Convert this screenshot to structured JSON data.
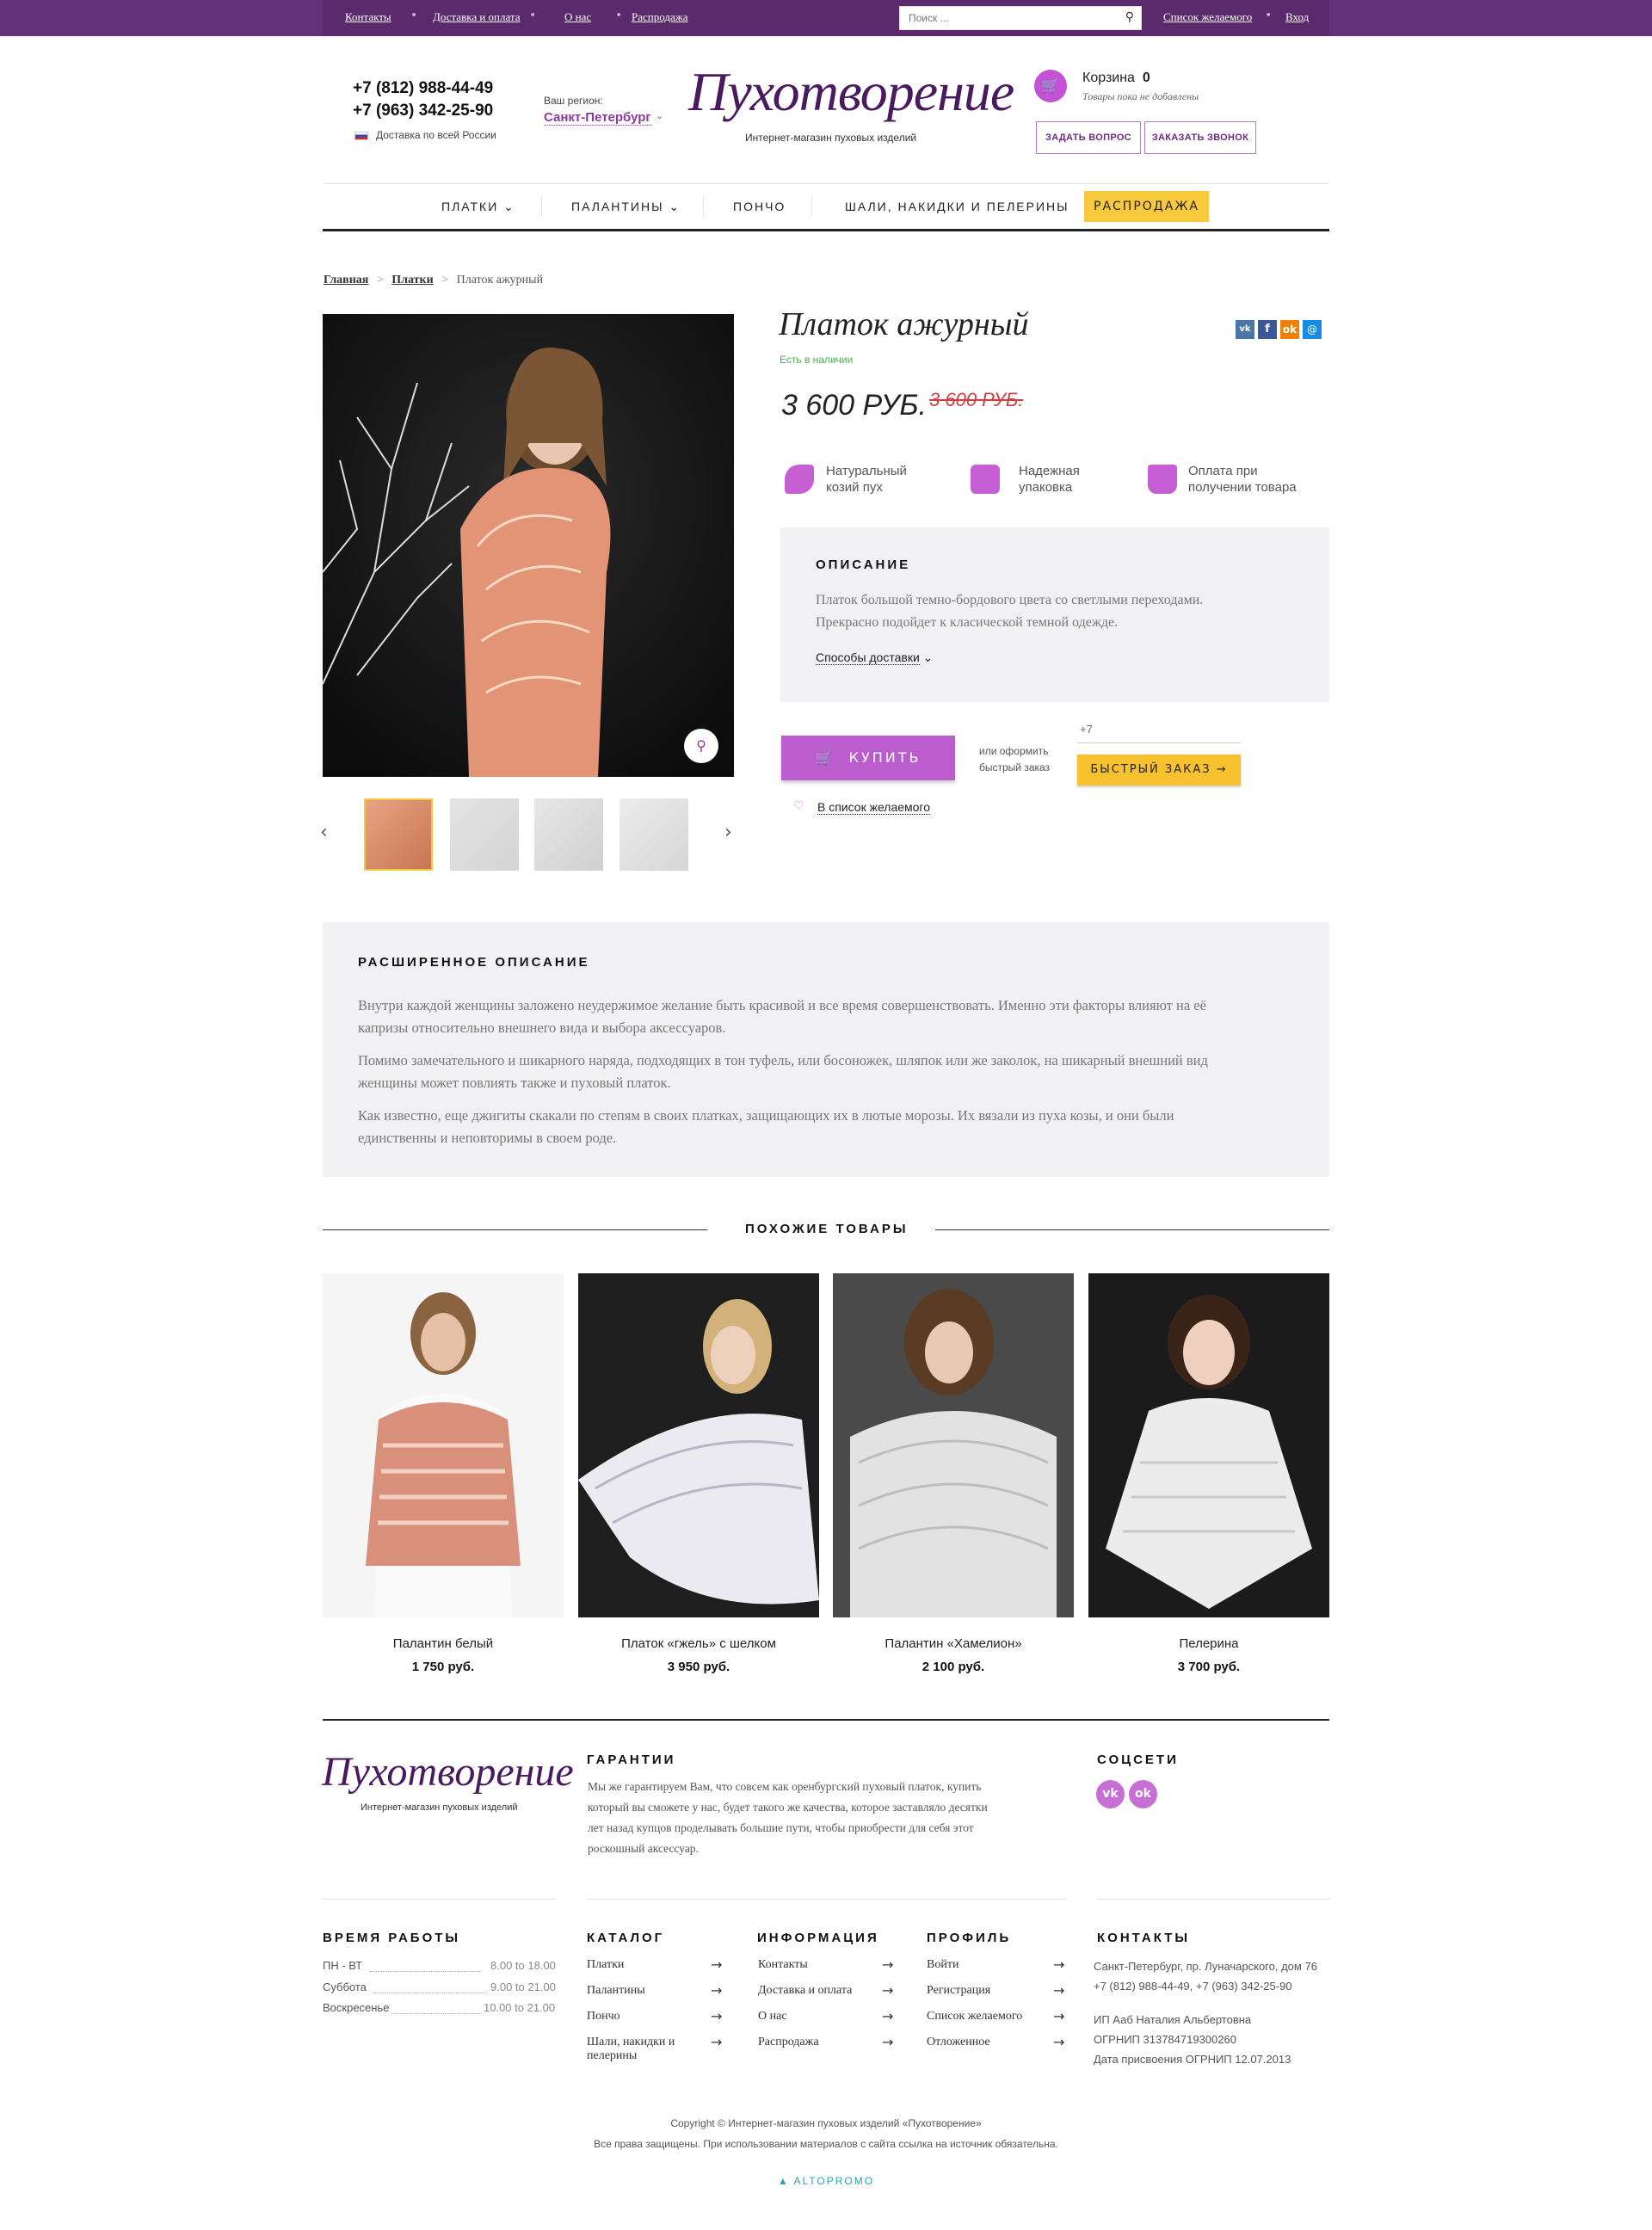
{
  "topbar": {
    "links": [
      "Контакты",
      "Доставка и оплата",
      "О нас",
      "Распродажа"
    ],
    "search_placeholder": "Поиск ...",
    "wishlist": "Список желаемого",
    "login": "Вход"
  },
  "header": {
    "phone1": "+7 (812) 988-44-49",
    "phone2": "+7 (963) 342-25-90",
    "delivery": "Доставка по всей России",
    "region_label": "Ваш регион:",
    "region": "Санкт-Петербург",
    "logo": "Пухотворение",
    "logo_sub": "Интернет-магазин пуховых изделий",
    "cart_label": "Корзина",
    "cart_count": "0",
    "cart_empty": "Товары пока не добавлены",
    "ask_button": "ЗАДАТЬ ВОПРОС",
    "call_button": "ЗАКАЗАТЬ ЗВОНОК"
  },
  "nav": {
    "items": [
      "ПЛАТКИ",
      "ПАЛАНТИНЫ",
      "ПОНЧО",
      "ШАЛИ, НАКИДКИ И ПЕЛЕРИНЫ"
    ],
    "sale": "РАСПРОДАЖА"
  },
  "breadcrumb": [
    "Главная",
    "Платки",
    "Платок ажурный"
  ],
  "product": {
    "title": "Платок ажурный",
    "stock": "Есть в наличии",
    "price": "3 600 РУБ.",
    "old_price": "3 600 РУБ.",
    "features": [
      {
        "line1": "Натуральный",
        "line2": "козий пух"
      },
      {
        "line1": "Надежная",
        "line2": "упаковка"
      },
      {
        "line1": "Оплата при",
        "line2": "получении товара"
      }
    ],
    "desc_title": "ОПИСАНИЕ",
    "desc_line1": "Платок большой темно-бордового цвета со светлыми переходами.",
    "desc_line2": "Прекрасно подойдет к класической темной одежде.",
    "delivery_toggle": "Способы доставки",
    "buy": "КУПИТЬ",
    "or1": "или оформить",
    "or2": "быстрый заказ",
    "phone_prefix": "+7",
    "quick": "БЫСТРЫЙ ЗАКАЗ →",
    "wishlist": "В список желаемого"
  },
  "extended": {
    "title": "РАСШИРЕННОЕ ОПИСАНИЕ",
    "p1a": "Внутри каждой женщины заложено неудержимое желание быть красивой и все время совершенствовать. Именно эти факторы влияют на её",
    "p1b": "капризы относительно внешнего вида и выбора аксессуаров.",
    "p2a": "Помимо замечательного и шикарного наряда, подходящих в тон туфель, или босоножек, шляпок или же заколок, на шикарный внешний вид",
    "p2b": "женщины может повлиять также и пуховый платок.",
    "p3a": "Как известно, еще джигиты скакали по степям в своих платках, защищающих их в лютые морозы. Их вязали из пуха козы, и они были",
    "p3b": "единственны и неповторимы в своем роде."
  },
  "similar": {
    "title": "ПОХОЖИЕ ТОВАРЫ",
    "items": [
      {
        "name": "Палантин белый",
        "price": "1 750 руб."
      },
      {
        "name": "Платок «гжель» с шелком",
        "price": "3 950 руб."
      },
      {
        "name": "Палантин «Хамелион»",
        "price": "2 100 руб."
      },
      {
        "name": "Пелерина",
        "price": "3 700 руб."
      }
    ]
  },
  "footer": {
    "guarantee_title": "ГАРАНТИИ",
    "guarantee_l1": "Мы же гарантируем Вам, что совсем как оренбургский пуховый платок, купить",
    "guarantee_l2": "который вы сможете у нас, будет такого же качества, которое заставляло десятки",
    "guarantee_l3": "лет назад купцов проделывать большие пути, чтобы приобрести для себя этот",
    "guarantee_l4": "роскошный аксессуар.",
    "social_title": "СОЦСЕТИ",
    "hours_title": "ВРЕМЯ РАБОТЫ",
    "hours": [
      {
        "day": "ПН - ВТ",
        "time": "8.00 to 18.00"
      },
      {
        "day": "Суббота",
        "time": "9.00 to 21.00"
      },
      {
        "day": "Воскресенье",
        "time": "10.00 to 21.00"
      }
    ],
    "catalog_title": "КАТАЛОГ",
    "catalog": [
      "Платки",
      "Палантины",
      "Пончо",
      "Шали, накидки и",
      "пелерины"
    ],
    "info_title": "ИНФОРМАЦИЯ",
    "info": [
      "Контакты",
      "Доставка и оплата",
      "О нас",
      "Распродажа"
    ],
    "profile_title": "ПРОФИЛЬ",
    "profile": [
      "Войти",
      "Регистрация",
      "Список желаемого",
      "Отложенное"
    ],
    "contacts_title": "КОНТАКТЫ",
    "address": "Санкт-Петербург, пр. Луначарского, дом 76",
    "phones": "+7 (812) 988-44-49, +7 (963) 342-25-90",
    "ip": "ИП Ааб Наталия Альбертовна",
    "ogrnip": "ОГРНИП 313784719300260",
    "ogrnip_date": "Дата присвоения ОГРНИП 12.07.2013",
    "copyright": "Copyright © Интернет-магазин пуховых изделий «Пухотворение»",
    "rights": "Все права защищены. При использовании материалов с сайта ссылка на источник обязательна.",
    "dev": "ALTOPROMO"
  }
}
